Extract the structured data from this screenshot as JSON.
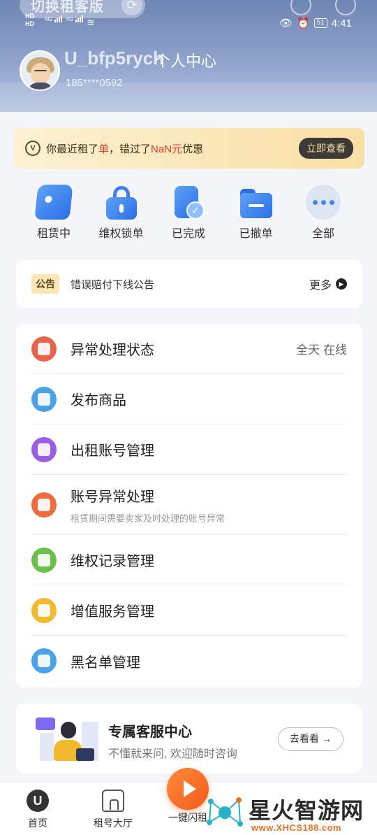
{
  "header": {
    "switch_label": "切换租客版",
    "username": "U_bfp5rych",
    "page_title": "个人中心",
    "phone": "185****0592"
  },
  "status_bar": {
    "net1": "HD",
    "net2": "HD",
    "sig1": "4G",
    "sig2": "4G",
    "battery": "51",
    "time": "4:41"
  },
  "promo": {
    "text_prefix": "你最近租了",
    "text_order": "单",
    "text_mid": "，错过了",
    "text_amount": "NaN元",
    "text_suffix": "优惠",
    "button": "立即查看"
  },
  "orders": [
    {
      "label": "租赁中",
      "icon": "gamepad-icon"
    },
    {
      "label": "维权锁单",
      "icon": "lock-icon"
    },
    {
      "label": "已完成",
      "icon": "check-doc-icon"
    },
    {
      "label": "已撤单",
      "icon": "folder-icon"
    },
    {
      "label": "全部",
      "icon": "more-icon"
    }
  ],
  "notice": {
    "tag": "公告",
    "text": "错误赔付下线公告",
    "more": "更多"
  },
  "menu": [
    {
      "title": "异常处理状态",
      "right": "全天 在线",
      "color": "#e9624a"
    },
    {
      "title": "发布商品",
      "color": "#4aa3e8"
    },
    {
      "title": "出租账号管理",
      "color": "#9b5de5"
    },
    {
      "title": "账号异常处理",
      "subtitle": "租赁期间需要卖家及时处理的账号异常",
      "color": "#ef6b3c"
    },
    {
      "title": "维权记录管理",
      "color": "#6cc04a"
    },
    {
      "title": "增值服务管理",
      "color": "#f2b92e"
    },
    {
      "title": "黑名单管理",
      "color": "#4aa3e8"
    }
  ],
  "service": {
    "title": "专属客服中心",
    "subtitle": "不懂就来问, 欢迎随时咨询",
    "button": "去看看 →"
  },
  "bottom_nav": [
    {
      "label": "首页",
      "icon": "home-icon"
    },
    {
      "label": "租号大厅",
      "icon": "hall-icon"
    },
    {
      "label": "一键闪租",
      "icon": "flash-rent-icon"
    }
  ],
  "watermark": {
    "brand": "星火智游网",
    "url": "www.XHCS188.com"
  }
}
